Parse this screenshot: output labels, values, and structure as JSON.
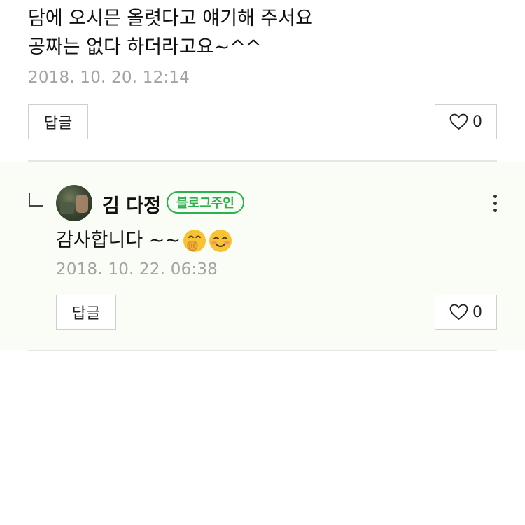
{
  "comment": {
    "lines": [
      "담에 오시믄 올렷다고 얘기해 주서요",
      "공짜는 없다 하더라고요~^^"
    ],
    "timestamp": "2018. 10. 20. 12:14",
    "reply_label": "답글",
    "like_count": "0"
  },
  "reply": {
    "author": "김 다정",
    "badge": "블로그주인",
    "text": "감사합니다 ~~",
    "emojis": [
      "hand-over-mouth-emoji",
      "smiling-blush-emoji"
    ],
    "timestamp": "2018. 10. 22. 06:38",
    "reply_label": "답글",
    "like_count": "0"
  },
  "colors": {
    "accent_green": "#2bb24c",
    "reply_bg": "#fafcf6",
    "timestamp": "#a3a3a3"
  }
}
